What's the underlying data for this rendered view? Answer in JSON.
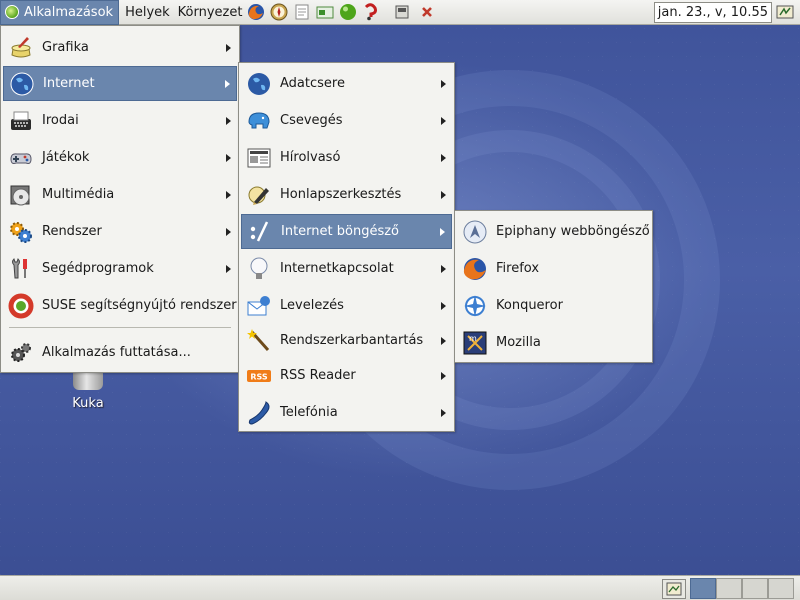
{
  "top_panel": {
    "applications_label": "Alkalmazások",
    "places_label": "Helyek",
    "desktop_label": "Környezet",
    "clock": "jan. 23., v, 10.55"
  },
  "desktop": {
    "trash_label": "Kuka"
  },
  "main_menu": {
    "items": [
      {
        "label": "Grafika",
        "icon": "graphics-icon"
      },
      {
        "label": "Internet",
        "icon": "globe-icon"
      },
      {
        "label": "Irodai",
        "icon": "typewriter-icon"
      },
      {
        "label": "Játékok",
        "icon": "gamepad-icon"
      },
      {
        "label": "Multimédia",
        "icon": "multimedia-icon"
      },
      {
        "label": "Rendszer",
        "icon": "system-gears-icon"
      },
      {
        "label": "Segédprogramok",
        "icon": "tools-icon"
      },
      {
        "label": "SUSE segítségnyújtó rendszer",
        "icon": "lifebuoy-icon"
      },
      {
        "label": "Alkalmazás futtatása...",
        "icon": "run-gears-icon"
      }
    ]
  },
  "internet_menu": {
    "items": [
      {
        "label": "Adatcsere",
        "icon": "globe-icon"
      },
      {
        "label": "Csevegés",
        "icon": "elephant-icon"
      },
      {
        "label": "Hírolvasó",
        "icon": "newspaper-icon"
      },
      {
        "label": "Honlapszerkesztés",
        "icon": "pen-icon"
      },
      {
        "label": "Internet böngésző",
        "icon": "browser-slash-icon"
      },
      {
        "label": "Internetkapcsolat",
        "icon": "bulb-icon"
      },
      {
        "label": "Levelezés",
        "icon": "mail-icon"
      },
      {
        "label": "Rendszerkarbantartás",
        "icon": "wand-icon"
      },
      {
        "label": "RSS Reader",
        "icon": "rss-icon"
      },
      {
        "label": "Telefónia",
        "icon": "phone-icon"
      }
    ]
  },
  "browser_menu": {
    "items": [
      {
        "label": "Epiphany webböngésző",
        "icon": "epiphany-icon"
      },
      {
        "label": "Firefox",
        "icon": "firefox-icon"
      },
      {
        "label": "Konqueror",
        "icon": "konqueror-icon"
      },
      {
        "label": "Mozilla",
        "icon": "mozilla-icon"
      }
    ]
  },
  "colors": {
    "selection": "#6a86ad",
    "menu_bg": "#f3f3f0",
    "desktop": "#3f539a"
  }
}
